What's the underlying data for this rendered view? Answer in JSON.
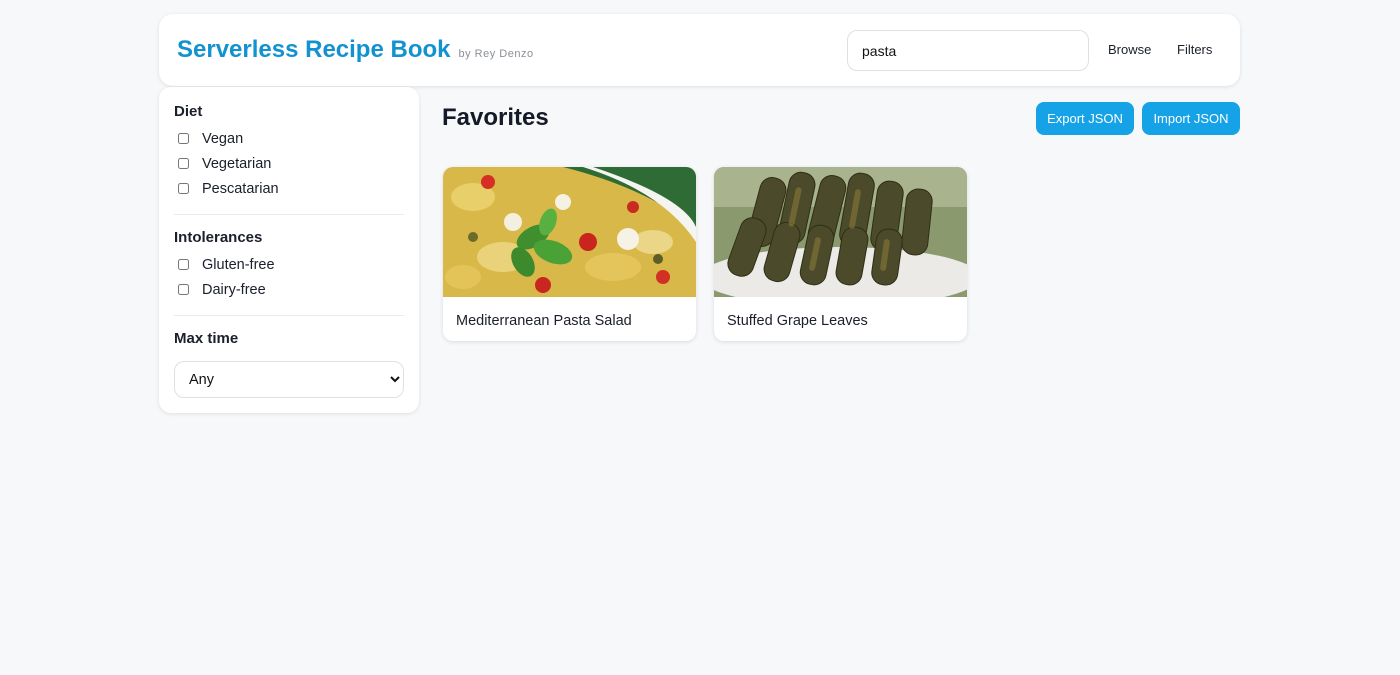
{
  "header": {
    "title": "Serverless Recipe Book",
    "subtitle": "by Rey Denzo",
    "search_value": "pasta",
    "nav": [
      "Browse",
      "Filters"
    ]
  },
  "sidebar": {
    "diet": {
      "title": "Diet",
      "options": [
        "Vegan",
        "Vegetarian",
        "Pescatarian"
      ]
    },
    "intolerances": {
      "title": "Intolerances",
      "options": [
        "Gluten-free",
        "Dairy-free"
      ]
    },
    "max_time": {
      "title": "Max time",
      "selected": "Any"
    }
  },
  "main": {
    "title": "Favorites",
    "export_label": "Export JSON",
    "import_label": "Import JSON",
    "cards": [
      {
        "title": "Mediterranean Pasta Salad"
      },
      {
        "title": "Stuffed Grape Leaves"
      }
    ]
  },
  "colors": {
    "brand": "#1392d2",
    "button": "#16a2e6",
    "background": "#f7f8fa"
  }
}
